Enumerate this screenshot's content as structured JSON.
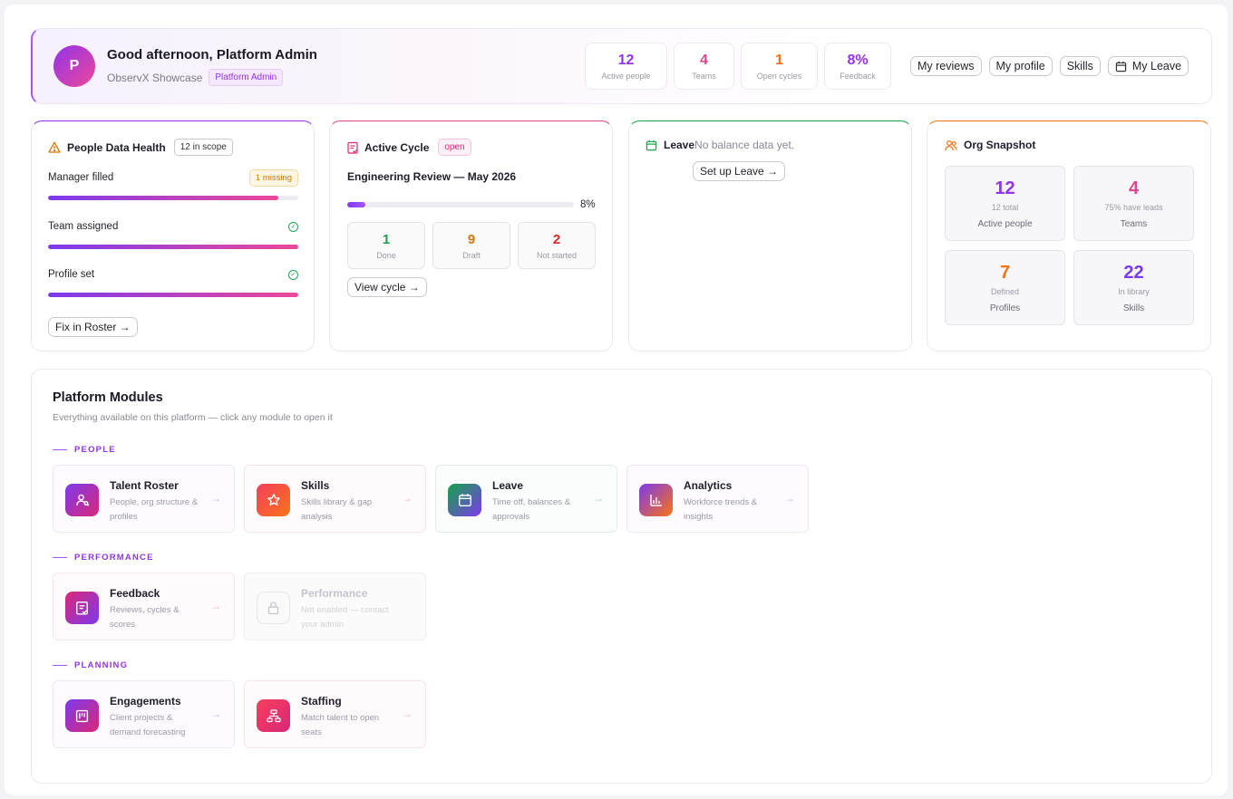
{
  "header": {
    "avatar_initial": "P",
    "greeting": "Good afternoon, Platform Admin",
    "org": "ObservX Showcase",
    "role": "Platform Admin",
    "stats": [
      {
        "value": "12",
        "label": "Active people",
        "color": "#9333ea"
      },
      {
        "value": "4",
        "label": "Teams",
        "color": "#e0448f"
      },
      {
        "value": "1",
        "label": "Open cycles",
        "color": "#f97316"
      },
      {
        "value": "8%",
        "label": "Feedback",
        "color": "#9333ea"
      }
    ],
    "buttons": {
      "my_reviews": "My reviews",
      "my_profile": "My profile",
      "skills": "Skills",
      "my_leave": "My Leave"
    }
  },
  "people_health": {
    "title": "People Data Health",
    "scope": "12 in scope",
    "metrics": [
      {
        "label": "Manager filled",
        "badge": "1 missing",
        "progress": 0.92
      },
      {
        "label": "Team assigned",
        "progress": 1.0
      },
      {
        "label": "Profile set",
        "progress": 1.0
      }
    ],
    "action": "Fix in Roster →"
  },
  "active_cycle": {
    "title": "Active Cycle",
    "status": "open",
    "name": "Engineering Review — May 2026",
    "progress": 0.08,
    "progress_label": "8%",
    "stats": [
      {
        "value": "1",
        "label": "Done",
        "color": "#16a34a"
      },
      {
        "value": "9",
        "label": "Draft",
        "color": "#d97706"
      },
      {
        "value": "2",
        "label": "Not started",
        "color": "#dc2626"
      }
    ],
    "action": "View cycle →"
  },
  "leave": {
    "title": "Leave",
    "empty": "No balance data yet.",
    "action": "Set up Leave →"
  },
  "org_snapshot": {
    "title": "Org Snapshot",
    "items": [
      {
        "value": "12",
        "sub": "12 total",
        "label": "Active people",
        "color": "#9333ea"
      },
      {
        "value": "4",
        "sub": "75% have leads",
        "label": "Teams",
        "color": "#e0448f"
      },
      {
        "value": "7",
        "sub": "Defined",
        "label": "Profiles",
        "color": "#f97316"
      },
      {
        "value": "22",
        "sub": "In library",
        "label": "Skills",
        "color": "#7c3aed"
      }
    ]
  },
  "modules": {
    "title": "Platform Modules",
    "subtitle": "Everything available on this platform — click any module to open it",
    "sections": {
      "people": "PEOPLE",
      "performance": "PERFORMANCE",
      "planning": "PLANNING"
    },
    "tiles": {
      "talent_roster": {
        "name": "Talent Roster",
        "desc": "People, org structure & profiles",
        "icon": "users-icon"
      },
      "skills": {
        "name": "Skills",
        "desc": "Skills library & gap analysis",
        "icon": "star-icon"
      },
      "leave": {
        "name": "Leave",
        "desc": "Time off, balances & approvals",
        "icon": "calendar-icon"
      },
      "analytics": {
        "name": "Analytics",
        "desc": "Workforce trends & insights",
        "icon": "bar-chart-icon"
      },
      "feedback": {
        "name": "Feedback",
        "desc": "Reviews, cycles & scores",
        "icon": "clipboard-icon"
      },
      "performance": {
        "name": "Performance",
        "desc": "Not enabled — contact your admin",
        "icon": "lock-icon"
      },
      "engagements": {
        "name": "Engagements",
        "desc": "Client projects & demand forecasting",
        "icon": "kanban-icon"
      },
      "staffing": {
        "name": "Staffing",
        "desc": "Match talent to open seats",
        "icon": "org-chart-icon"
      }
    }
  }
}
